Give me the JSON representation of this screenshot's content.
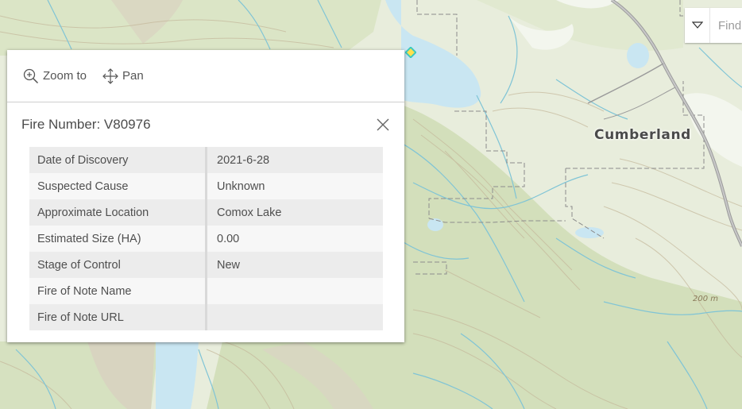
{
  "map": {
    "city_label": "Cumberland",
    "elevation_label": "200 m",
    "colors": {
      "land": "#e8eddc",
      "forest": "#d6e2bf",
      "water": "#c9e6f2",
      "stream": "#7fc4d6",
      "road": "#9b9b9b",
      "boundary": "#8c8c8c",
      "marker": "#3cc8c0"
    }
  },
  "search": {
    "placeholder": "Find",
    "toggle_icon": "chevron-down-icon"
  },
  "popup": {
    "actions": [
      {
        "label": "Zoom to",
        "icon": "zoom-in-icon"
      },
      {
        "label": "Pan",
        "icon": "move-icon"
      }
    ],
    "title": "Fire Number: V80976",
    "close_icon": "close-icon",
    "attributes": [
      {
        "key": "Date of Discovery",
        "value": "2021-6-28"
      },
      {
        "key": "Suspected Cause",
        "value": "Unknown"
      },
      {
        "key": "Approximate Location",
        "value": "Comox Lake"
      },
      {
        "key": "Estimated Size (HA)",
        "value": "0.00"
      },
      {
        "key": "Stage of Control",
        "value": "New"
      },
      {
        "key": "Fire of Note Name",
        "value": ""
      },
      {
        "key": "Fire of Note URL",
        "value": ""
      }
    ]
  }
}
